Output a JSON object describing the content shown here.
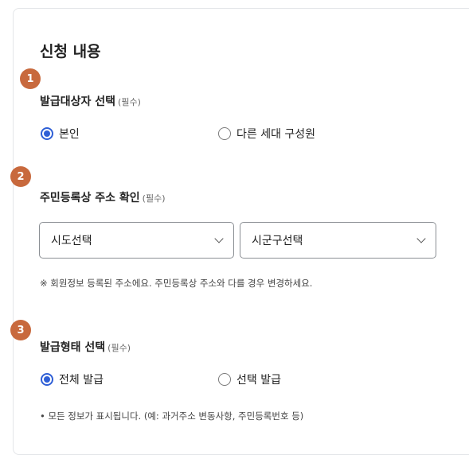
{
  "section": {
    "title": "신청 내용"
  },
  "steps": [
    {
      "number": "1",
      "label": "발급대상자 선택",
      "required": "(필수)",
      "options": [
        {
          "label": "본인",
          "checked": true
        },
        {
          "label": "다른 세대 구성원",
          "checked": false
        }
      ]
    },
    {
      "number": "2",
      "label": "주민등록상 주소 확인",
      "required": "(필수)",
      "selects": [
        {
          "value": "시도선택"
        },
        {
          "value": "시군구선택"
        }
      ],
      "note": "※ 회원정보 등록된 주소에요. 주민등록상 주소와 다를 경우 변경하세요."
    },
    {
      "number": "3",
      "label": "발급형태 선택",
      "required": "(필수)",
      "options": [
        {
          "label": "전체 발급",
          "checked": true
        },
        {
          "label": "선택 발급",
          "checked": false
        }
      ],
      "note": "• 모든 정보가 표시됩니다. (예: 과거주소 변동사항, 주민등록번호 등)"
    }
  ],
  "colors": {
    "badge": "#c8693d",
    "radio_accent": "#2f5fd6"
  }
}
